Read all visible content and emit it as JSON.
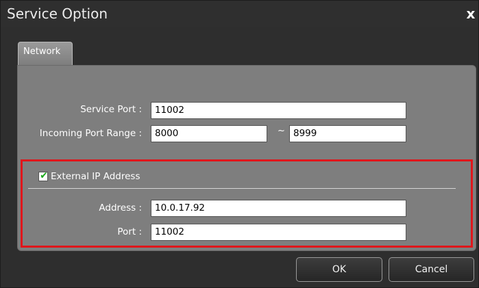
{
  "window": {
    "title": "Service Option",
    "close_glyph": "x"
  },
  "tabs": [
    {
      "label": "Network"
    }
  ],
  "network": {
    "service_port": {
      "label": "Service Port :",
      "value": "11002"
    },
    "incoming_port_range": {
      "label": "Incoming Port Range :",
      "from": "8000",
      "separator": "~",
      "to": "8999"
    },
    "external_ip": {
      "checkbox_label": "External IP Address",
      "checked": true,
      "address": {
        "label": "Address :",
        "value": "10.0.17.92"
      },
      "port": {
        "label": "Port :",
        "value": "11002"
      }
    }
  },
  "buttons": {
    "ok": "OK",
    "cancel": "Cancel"
  },
  "colors": {
    "highlight_border": "#e0161b",
    "dialog_background": "#2e2e2e",
    "panel_background": "#7e7e7e",
    "check_mark": "#1aa81a"
  },
  "icons": {
    "close": "close-icon",
    "checkbox": "checkbox-checked-icon"
  }
}
